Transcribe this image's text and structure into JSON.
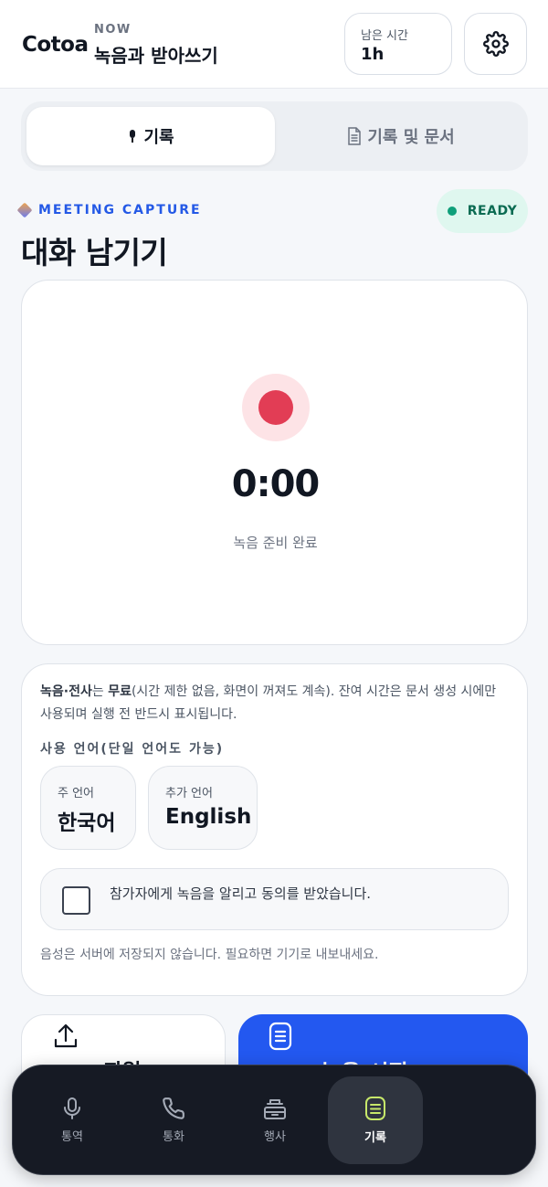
{
  "header": {
    "logo": "Cotoa",
    "now_label": "NOW",
    "now_title": "녹음과 받아쓰기",
    "remaining_label": "남은 시간",
    "remaining_value": "1h",
    "settings_icon": "gear-icon"
  },
  "tabs": [
    {
      "label": "기록",
      "icon": "microphone-icon",
      "active": true
    },
    {
      "label": "기록 및 문서",
      "icon": "document-icon",
      "active": false
    }
  ],
  "section": {
    "eyebrow": "MEETING CAPTURE",
    "status": "READY",
    "title": "대화 남기기"
  },
  "recorder": {
    "timer": "0:00",
    "status": "녹음 준비 완료",
    "record_color": "#e23d55"
  },
  "settings": {
    "notice_bold_1": "녹음·전사",
    "notice_mid": "는 ",
    "notice_bold_2": "무료",
    "notice_rest": "(시간 제한 없음, 화면이 꺼져도 계속). 잔여 시간은 문서 생성 시에만 사용되며 실행 전 반드시 표시됩니다.",
    "language_label": "사용 언어(단일 언어도 가능)",
    "primary_label": "주 언어",
    "primary_value": "한국어",
    "secondary_label": "추가 언어",
    "secondary_value": "English",
    "consent_text": "참가자에게 녹음을 알리고 동의를 받았습니다.",
    "consent_checked": false,
    "privacy_note": "음성은 서버에 저장되지 않습니다. 필요하면 기기로 내보내세요."
  },
  "actions": {
    "file_label": "파일",
    "start_label": "녹음 시작",
    "accent": "#2358f0"
  },
  "bottom_nav": [
    {
      "label": "통역",
      "icon": "microphone-icon",
      "active": false
    },
    {
      "label": "통화",
      "icon": "phone-icon",
      "active": false
    },
    {
      "label": "행사",
      "icon": "podium-icon",
      "active": false
    },
    {
      "label": "기록",
      "icon": "notes-icon",
      "active": true
    }
  ]
}
